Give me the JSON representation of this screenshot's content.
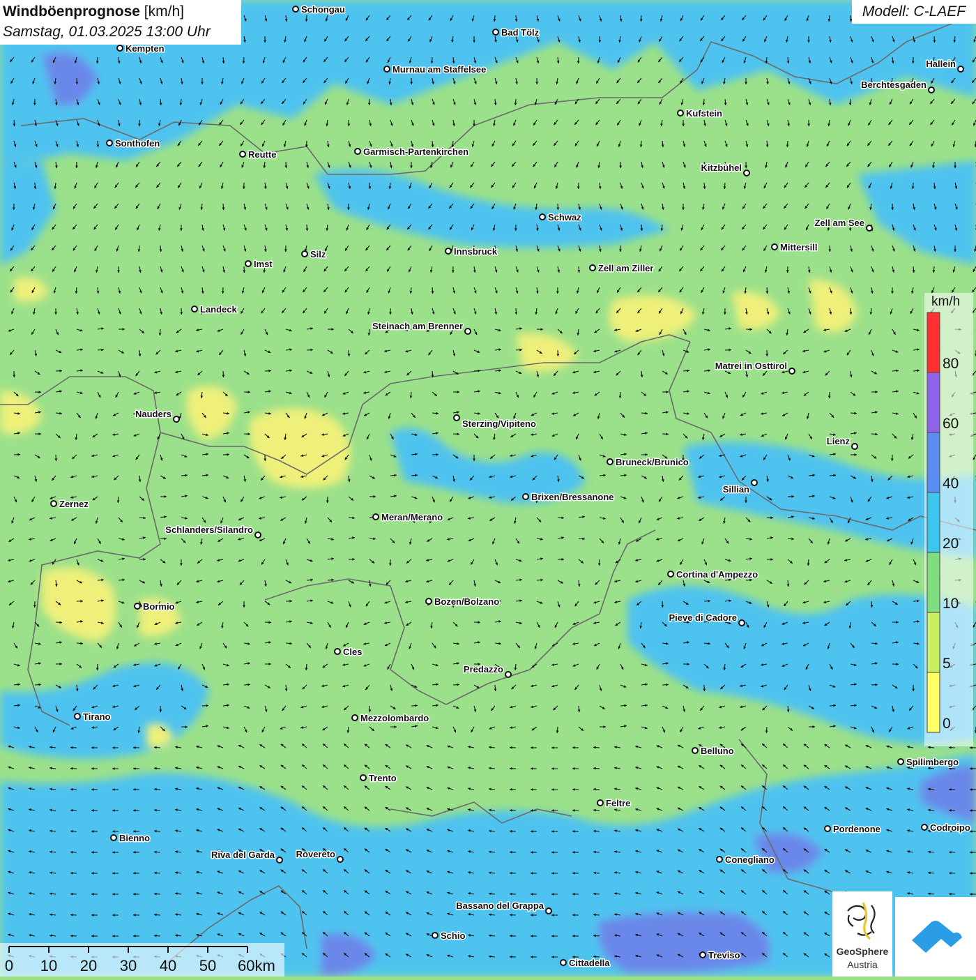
{
  "title": {
    "main_bold": "Windböenprognose",
    "main_unit": " [km/h]",
    "subtitle": "Samstag, 01.03.2025 13:00 Uhr"
  },
  "model": "Modell: C-LAEF",
  "legend": {
    "unit": "km/h",
    "ticks": [
      "80",
      "60",
      "40",
      "20",
      "10",
      "5",
      "0"
    ],
    "colors": [
      "#ff3030",
      "#8e63ea",
      "#5a8df0",
      "#3cc6ee",
      "#7fdf7f",
      "#c8f060",
      "#ffff66"
    ]
  },
  "scalebar": {
    "labels": [
      "0",
      "10",
      "20",
      "30",
      "40",
      "50",
      "60km"
    ]
  },
  "logo": {
    "name": "GeoSphere",
    "sub": "Austria"
  },
  "colors": {
    "wind_low": "#9be08a",
    "wind_mid": "#4fc3ef",
    "wind_calm": "#eef07a",
    "wind_high": "#6b88ea"
  },
  "cities": [
    {
      "name": "Schongau"
    },
    {
      "name": "Bad Tölz"
    },
    {
      "name": "Kempten"
    },
    {
      "name": "Murnau am Staffelsee"
    },
    {
      "name": "Hallein"
    },
    {
      "name": "Berchtesgaden"
    },
    {
      "name": "Kufstein"
    },
    {
      "name": "Sonthofen"
    },
    {
      "name": "Reutte"
    },
    {
      "name": "Garmisch-Partenkirchen"
    },
    {
      "name": "Kitzbühel"
    },
    {
      "name": "Schwaz"
    },
    {
      "name": "Zell am See"
    },
    {
      "name": "Mittersill"
    },
    {
      "name": "Innsbruck"
    },
    {
      "name": "Silz"
    },
    {
      "name": "Imst"
    },
    {
      "name": "Zell am Ziller"
    },
    {
      "name": "Landeck"
    },
    {
      "name": "Steinach am Brenner"
    },
    {
      "name": "Matrei in Osttirol"
    },
    {
      "name": "Nauders"
    },
    {
      "name": "Sterzing/Vipiteno"
    },
    {
      "name": "Lienz"
    },
    {
      "name": "Bruneck/Brunico"
    },
    {
      "name": "Sillian"
    },
    {
      "name": "Zernez"
    },
    {
      "name": "Brixen/Bressanone"
    },
    {
      "name": "Meran/Merano"
    },
    {
      "name": "Schlanders/Silandro"
    },
    {
      "name": "Cortina d'Ampezzo"
    },
    {
      "name": "Bozen/Bolzano"
    },
    {
      "name": "Bormio"
    },
    {
      "name": "Pieve di Cadore"
    },
    {
      "name": "Cles"
    },
    {
      "name": "Predazzo"
    },
    {
      "name": "Tirano"
    },
    {
      "name": "Mezzolombardo"
    },
    {
      "name": "Belluno"
    },
    {
      "name": "Spilimbergo"
    },
    {
      "name": "Trento"
    },
    {
      "name": "Feltre"
    },
    {
      "name": "Pordenone"
    },
    {
      "name": "Codroipo"
    },
    {
      "name": "Bienno"
    },
    {
      "name": "Riva del Garda"
    },
    {
      "name": "Rovereto"
    },
    {
      "name": "Conegliano"
    },
    {
      "name": "Bassano del Grappa"
    },
    {
      "name": "Schio"
    },
    {
      "name": "Treviso"
    },
    {
      "name": "Cittadella"
    }
  ]
}
